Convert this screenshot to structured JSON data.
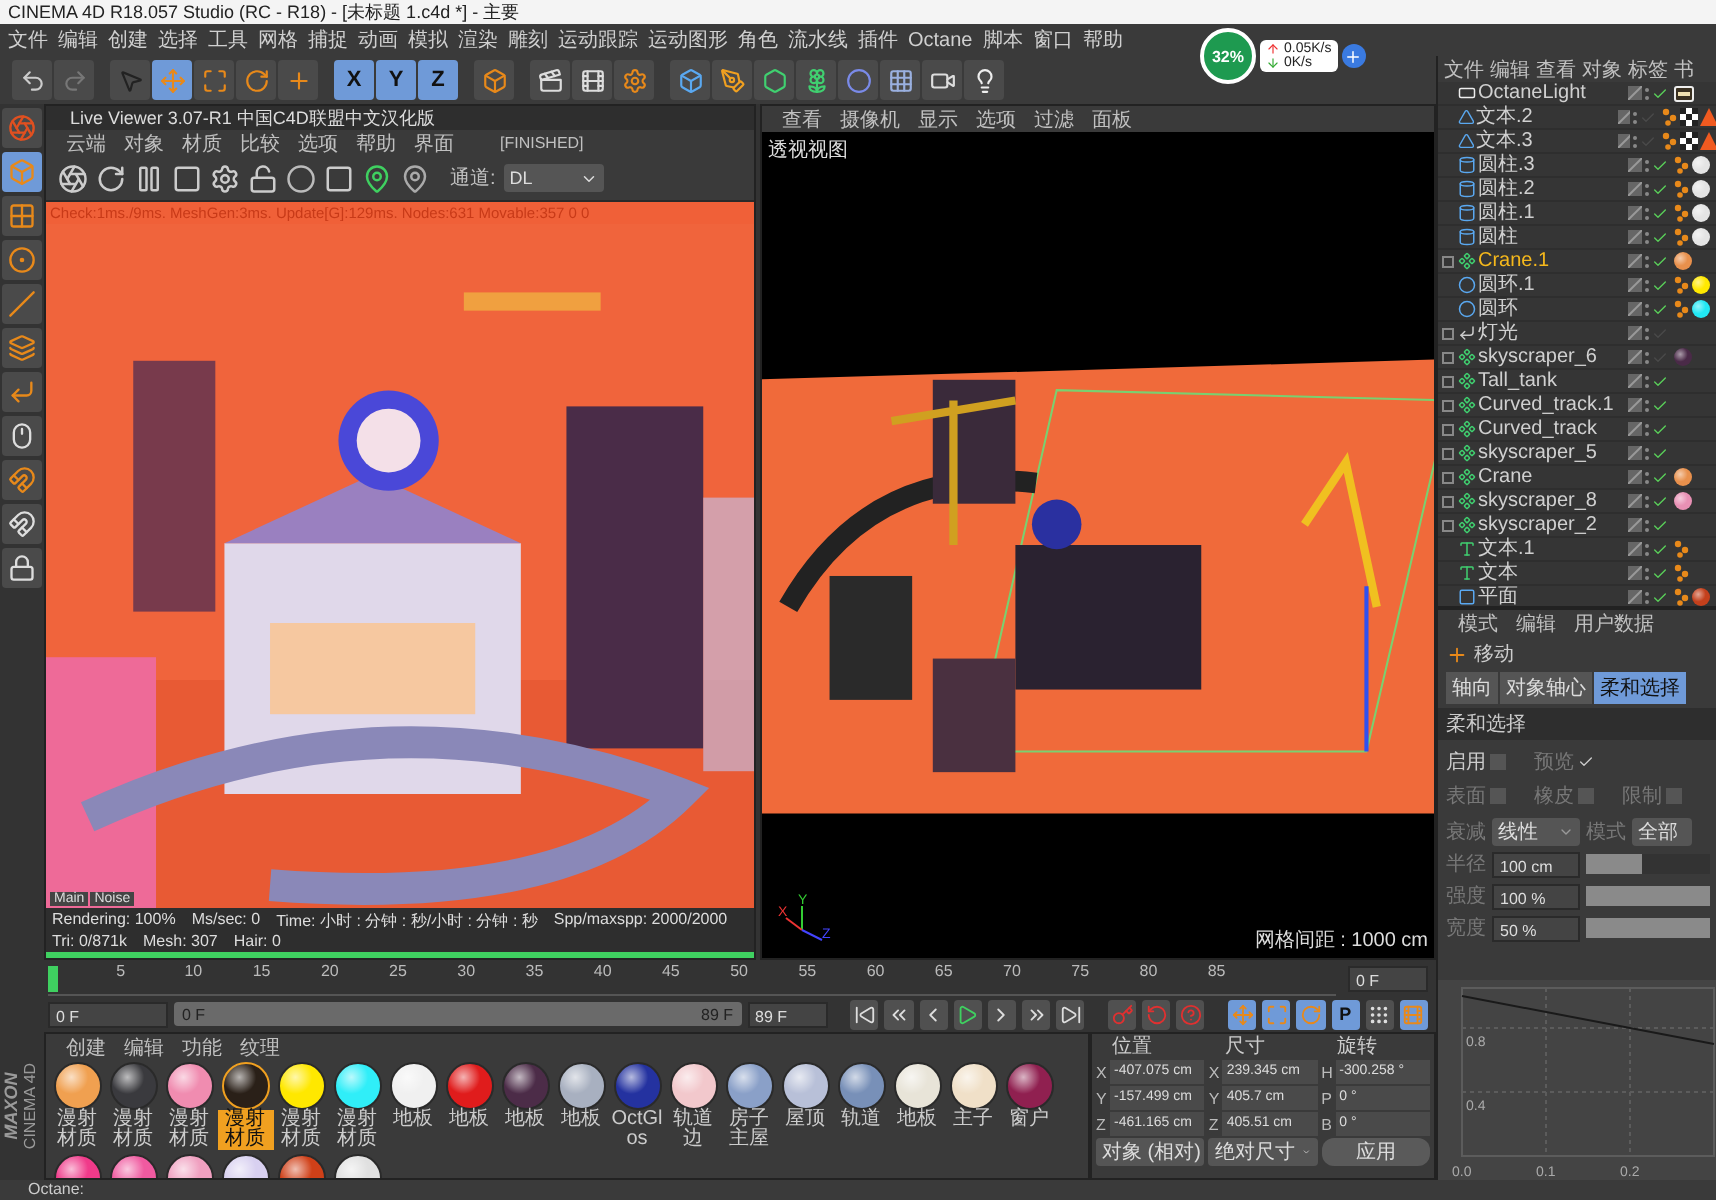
{
  "window": {
    "title": "CINEMA 4D R18.057 Studio (RC - R18) - [未标题 1.c4d *] - 主要"
  },
  "menu": [
    "文件",
    "编辑",
    "创建",
    "选择",
    "工具",
    "网格",
    "捕捉",
    "动画",
    "模拟",
    "渲染",
    "雕刻",
    "运动跟踪",
    "运动图形",
    "角色",
    "流水线",
    "插件",
    "Octane",
    "脚本",
    "窗口",
    "帮助"
  ],
  "network": {
    "percent": "32%",
    "upload": "0.05K/s",
    "download": "0K/s"
  },
  "toolbar": [
    {
      "kind": "undo",
      "selected": false
    },
    {
      "kind": "redo",
      "selected": false
    },
    {
      "kind": "select",
      "selected": false
    },
    {
      "kind": "move",
      "selected": true
    },
    {
      "kind": "scale",
      "selected": false
    },
    {
      "kind": "rotate",
      "selected": false
    },
    {
      "kind": "add",
      "selected": false
    },
    {
      "kind": "axis",
      "label": "X",
      "selected": true
    },
    {
      "kind": "axis",
      "label": "Y",
      "selected": true
    },
    {
      "kind": "axis",
      "label": "Z",
      "selected": true
    },
    {
      "kind": "coords",
      "selected": false
    },
    {
      "kind": "render",
      "selected": false
    },
    {
      "kind": "render_view",
      "selected": false
    },
    {
      "kind": "render_settings",
      "selected": false
    },
    {
      "kind": "cube",
      "selected": false
    },
    {
      "kind": "pen",
      "selected": false
    },
    {
      "kind": "subdivide",
      "selected": false
    },
    {
      "kind": "cloner",
      "selected": false
    },
    {
      "kind": "deformer",
      "selected": false
    },
    {
      "kind": "floor",
      "selected": false
    },
    {
      "kind": "camera",
      "selected": false
    },
    {
      "kind": "light",
      "selected": false
    }
  ],
  "left_tools": [
    {
      "kind": "octane",
      "selected": false
    },
    {
      "kind": "model",
      "selected": true
    },
    {
      "kind": "texture",
      "selected": false
    },
    {
      "kind": "points",
      "selected": false
    },
    {
      "kind": "edges",
      "selected": false
    },
    {
      "kind": "polygons",
      "selected": false
    },
    {
      "kind": "axis",
      "selected": false
    },
    {
      "kind": "tweak",
      "selected": false
    },
    {
      "kind": "snap",
      "selected": false
    },
    {
      "kind": "magnet",
      "selected": false
    },
    {
      "kind": "lock",
      "selected": false
    }
  ],
  "live_viewer": {
    "title": "Live Viewer 3.07-R1 中国C4D联盟中文汉化版",
    "menu": [
      "云端",
      "对象",
      "材质",
      "比较",
      "选项",
      "帮助",
      "界面"
    ],
    "status": "[FINISHED]",
    "tools": [
      {
        "kind": "aperture"
      },
      {
        "kind": "refresh"
      },
      {
        "kind": "pause"
      },
      {
        "kind": "restart"
      },
      {
        "kind": "settings"
      },
      {
        "kind": "unlock"
      },
      {
        "kind": "sphere"
      },
      {
        "kind": "region"
      },
      {
        "kind": "pin_active"
      },
      {
        "kind": "pin"
      }
    ],
    "channel_label": "通道:",
    "channel": "DL",
    "check_line": "Check:1ms./9ms. MeshGen:3ms. Update[G]:129ms. Nodes:631 Movable:357  0 0",
    "layer_tabs": [
      "Main",
      "Noise"
    ],
    "stats": [
      "Rendering: 100%",
      "Ms/sec: 0",
      "Time: 小时 : 分钟 : 秒/小时 : 分钟 : 秒",
      "Spp/maxspp: 2000/2000",
      "Tri: 0/871k",
      "Mesh: 307",
      "Hair: 0"
    ],
    "progress": {
      "level": 1
    }
  },
  "viewport": {
    "menu": [
      "查看",
      "摄像机",
      "显示",
      "选项",
      "过滤",
      "面板"
    ],
    "label": "透视视图",
    "axes": [
      "X",
      "Y",
      "Z"
    ],
    "grid_spacing": "网格间距 : 1000 cm"
  },
  "object_manager": {
    "menu": [
      "文件",
      "编辑",
      "查看",
      "对象",
      "标签",
      "书"
    ],
    "objects": [
      {
        "name": "OctaneLight",
        "kind": "light",
        "expandable": false,
        "selected": false,
        "enabled": true,
        "tags": [
          {
            "kind": "light"
          }
        ]
      },
      {
        "name": "文本.2",
        "kind": "extrude",
        "expandable": false,
        "selected": false,
        "enabled": false,
        "tags": [
          {
            "kind": "phong"
          },
          {
            "kind": "checker"
          },
          {
            "kind": "warning"
          }
        ]
      },
      {
        "name": "文本.3",
        "kind": "extrude",
        "expandable": false,
        "selected": false,
        "enabled": false,
        "tags": [
          {
            "kind": "phong"
          },
          {
            "kind": "checker"
          },
          {
            "kind": "warning"
          }
        ]
      },
      {
        "name": "圆柱.3",
        "kind": "cylinder",
        "expandable": false,
        "selected": false,
        "enabled": true,
        "tags": [
          {
            "kind": "phong"
          },
          {
            "kind": "material",
            "color": "#e4e4e4"
          }
        ]
      },
      {
        "name": "圆柱.2",
        "kind": "cylinder",
        "expandable": false,
        "selected": false,
        "enabled": true,
        "tags": [
          {
            "kind": "phong"
          },
          {
            "kind": "material",
            "color": "#e4e4e4"
          }
        ]
      },
      {
        "name": "圆柱.1",
        "kind": "cylinder",
        "expandable": false,
        "selected": false,
        "enabled": true,
        "tags": [
          {
            "kind": "phong"
          },
          {
            "kind": "material",
            "color": "#e4e4e4"
          }
        ]
      },
      {
        "name": "圆柱",
        "kind": "cylinder",
        "expandable": false,
        "selected": false,
        "enabled": true,
        "tags": [
          {
            "kind": "phong"
          },
          {
            "kind": "material",
            "color": "#e4e4e4"
          }
        ]
      },
      {
        "name": "Crane.1",
        "kind": "null",
        "expandable": true,
        "selected": true,
        "enabled": true,
        "tags": [
          {
            "kind": "material",
            "color": "#e8904c"
          }
        ]
      },
      {
        "name": "圆环.1",
        "kind": "torus",
        "expandable": false,
        "selected": false,
        "enabled": true,
        "tags": [
          {
            "kind": "phong"
          },
          {
            "kind": "material",
            "color": "#ffe800"
          }
        ]
      },
      {
        "name": "圆环",
        "kind": "torus",
        "expandable": false,
        "selected": false,
        "enabled": true,
        "tags": [
          {
            "kind": "phong"
          },
          {
            "kind": "material",
            "color": "#22e8f4"
          }
        ]
      },
      {
        "name": "灯光",
        "kind": "folder",
        "expandable": true,
        "selected": false,
        "enabled": false
      },
      {
        "name": "skyscraper_6",
        "kind": "null",
        "expandable": true,
        "selected": false,
        "enabled": false,
        "tags": [
          {
            "kind": "material",
            "color": "#4a2a48"
          }
        ]
      },
      {
        "name": "Tall_tank",
        "kind": "null",
        "expandable": true,
        "selected": false,
        "enabled": true
      },
      {
        "name": "Curved_track.1",
        "kind": "null",
        "expandable": true,
        "selected": false,
        "enabled": true
      },
      {
        "name": "Curved_track",
        "kind": "null",
        "expandable": true,
        "selected": false,
        "enabled": true
      },
      {
        "name": "skyscraper_5",
        "kind": "null",
        "expandable": true,
        "selected": false,
        "enabled": true
      },
      {
        "name": "Crane",
        "kind": "null",
        "expandable": true,
        "selected": false,
        "enabled": true,
        "tags": [
          {
            "kind": "material",
            "color": "#e8904c"
          }
        ]
      },
      {
        "name": "skyscraper_8",
        "kind": "null",
        "expandable": true,
        "selected": false,
        "enabled": true,
        "tags": [
          {
            "kind": "material",
            "color": "#e890b4"
          }
        ]
      },
      {
        "name": "skyscraper_2",
        "kind": "null",
        "expandable": true,
        "selected": false,
        "enabled": true
      },
      {
        "name": "文本.1",
        "kind": "text",
        "expandable": false,
        "selected": false,
        "enabled": true,
        "tags": [
          {
            "kind": "phong"
          }
        ]
      },
      {
        "name": "文本",
        "kind": "text",
        "expandable": false,
        "selected": false,
        "enabled": true,
        "tags": [
          {
            "kind": "phong"
          }
        ]
      },
      {
        "name": "平面",
        "kind": "plane",
        "expandable": false,
        "selected": false,
        "enabled": true,
        "tags": [
          {
            "kind": "phong"
          },
          {
            "kind": "material",
            "color": "#c4401c"
          }
        ]
      }
    ]
  },
  "attributes": {
    "menu": [
      "模式",
      "编辑",
      "用户数据"
    ],
    "tool": "移动",
    "tabs": [
      {
        "label": "轴向",
        "selected": false
      },
      {
        "label": "对象轴心",
        "selected": false
      },
      {
        "label": "柔和选择",
        "selected": true
      }
    ],
    "section": "柔和选择",
    "check_rows": [
      [
        {
          "label": "启用",
          "checked": false
        },
        {
          "label": "预览",
          "checked": true
        }
      ],
      [
        {
          "label": "表面",
          "checked": false
        },
        {
          "label": "橡皮",
          "checked": false
        },
        {
          "label": "限制",
          "checked": false
        }
      ]
    ],
    "falloff": {
      "label": "衰减",
      "value": "线性"
    },
    "mode": {
      "label": "模式",
      "value": "全部"
    },
    "sliders": [
      {
        "label": "半径",
        "value": "100 cm",
        "level": 0.45
      },
      {
        "label": "强度",
        "value": "100 %",
        "level": 1
      },
      {
        "label": "宽度",
        "value": "50 %",
        "level": 1
      }
    ],
    "chart_data": {
      "type": "line",
      "x": [
        0,
        0.3
      ],
      "series": [
        {
          "color": "#1a1a1a",
          "values": [
            1,
            0.7
          ]
        }
      ],
      "xlim": [
        0,
        0.3
      ],
      "ylim": [
        0,
        1.05
      ],
      "grid": true,
      "xticks": [
        {
          "value": 0,
          "label": "0.0"
        },
        0.1,
        0.2
      ],
      "yticks": [
        0.4,
        0.8
      ]
    }
  },
  "timeline": {
    "ticks": [
      "5",
      "10",
      "15",
      "20",
      "25",
      "30",
      "35",
      "40",
      "45",
      "50",
      "55",
      "60",
      "65",
      "70",
      "75",
      "80",
      "85"
    ],
    "playhead": {
      "level": 0
    },
    "frame": "0 F"
  },
  "transport": {
    "start": "0 F",
    "range_start": "0 F",
    "range_end": "89 F",
    "range": {
      "level": 1
    },
    "end": "89 F",
    "buttons": [
      {
        "kind": "first",
        "selected": false
      },
      {
        "kind": "prev_key",
        "selected": false
      },
      {
        "kind": "prev_frame",
        "selected": false
      },
      {
        "kind": "play",
        "selected": false
      },
      {
        "kind": "next_frame",
        "selected": false
      },
      {
        "kind": "next_key",
        "selected": false
      },
      {
        "kind": "last",
        "selected": false
      },
      {
        "kind": "record",
        "selected": false
      },
      {
        "kind": "auto_key",
        "selected": false
      },
      {
        "kind": "key_help",
        "selected": false
      },
      {
        "kind": "key_move",
        "selected": true
      },
      {
        "kind": "key_scale",
        "selected": true
      },
      {
        "kind": "key_rotate",
        "selected": true
      },
      {
        "kind": "key_param",
        "label": "P",
        "selected": true
      },
      {
        "kind": "key_points",
        "selected": false
      },
      {
        "kind": "timeline",
        "selected": true
      }
    ]
  },
  "logo": {
    "brand": "MAXON",
    "product": "CINEMA 4D"
  },
  "materials": {
    "menu": [
      "创建",
      "编辑",
      "功能",
      "纹理"
    ],
    "items": [
      {
        "name": "漫射材质",
        "color": "#f0a050",
        "selected": false
      },
      {
        "name": "漫射材质",
        "color": "#3a3a3e",
        "selected": false
      },
      {
        "name": "漫射材质",
        "color": "#f08cb0",
        "selected": false
      },
      {
        "name": "漫射材质",
        "color": "#2a2018",
        "selected": true
      },
      {
        "name": "漫射材质",
        "color": "#ffe800",
        "selected": false
      },
      {
        "name": "漫射材质",
        "color": "#30eef8",
        "selected": false
      },
      {
        "name": "地板",
        "color": "#f0f0f0",
        "selected": false
      },
      {
        "name": "地板",
        "color": "#e01c1c",
        "selected": false
      },
      {
        "name": "地板",
        "color": "#4c2c48",
        "selected": false
      },
      {
        "name": "地板",
        "color": "#a8b0c0",
        "selected": false
      },
      {
        "name": "OctGlos",
        "color": "#2432a0",
        "selected": false
      },
      {
        "name": "轨道边",
        "color": "#f2c8cc",
        "selected": false
      },
      {
        "name": "房子主屋",
        "color": "#8aa0c8",
        "selected": false
      },
      {
        "name": "屋顶",
        "color": "#b8c0d8",
        "selected": false
      },
      {
        "name": "轨道",
        "color": "#7890b8",
        "selected": false
      },
      {
        "name": "地板",
        "color": "#e8e4d8",
        "selected": false
      },
      {
        "name": "主子",
        "color": "#f0e0c8",
        "selected": false
      },
      {
        "name": "窗户",
        "color": "#902050",
        "selected": false
      },
      {
        "color": "#f03a8a",
        "selected": false
      },
      {
        "color": "#f05aa0",
        "selected": false
      },
      {
        "color": "#f0a0c0",
        "selected": false
      },
      {
        "color": "#d8d0f0",
        "selected": false
      },
      {
        "color": "#d04018",
        "selected": false
      },
      {
        "color": "#e0e0e0",
        "selected": false
      }
    ]
  },
  "coordinates": {
    "headers": [
      "位置",
      "尺寸",
      "旋转"
    ],
    "rows": [
      [
        {
          "axis": "X",
          "value": "-407.075 cm"
        },
        {
          "axis": "X",
          "value": "239.345 cm"
        },
        {
          "axis": "H",
          "value": "-300.258 °"
        }
      ],
      [
        {
          "axis": "Y",
          "value": "-157.499 cm"
        },
        {
          "axis": "Y",
          "value": "405.7 cm"
        },
        {
          "axis": "P",
          "value": "0 °"
        }
      ],
      [
        {
          "axis": "Z",
          "value": "-461.165 cm"
        },
        {
          "axis": "Z",
          "value": "405.51 cm"
        },
        {
          "axis": "B",
          "value": "0 °"
        }
      ]
    ],
    "mode": "对象 (相对)",
    "size_mode": "绝对尺寸",
    "apply": "应用"
  },
  "status_bar": "Octane:"
}
